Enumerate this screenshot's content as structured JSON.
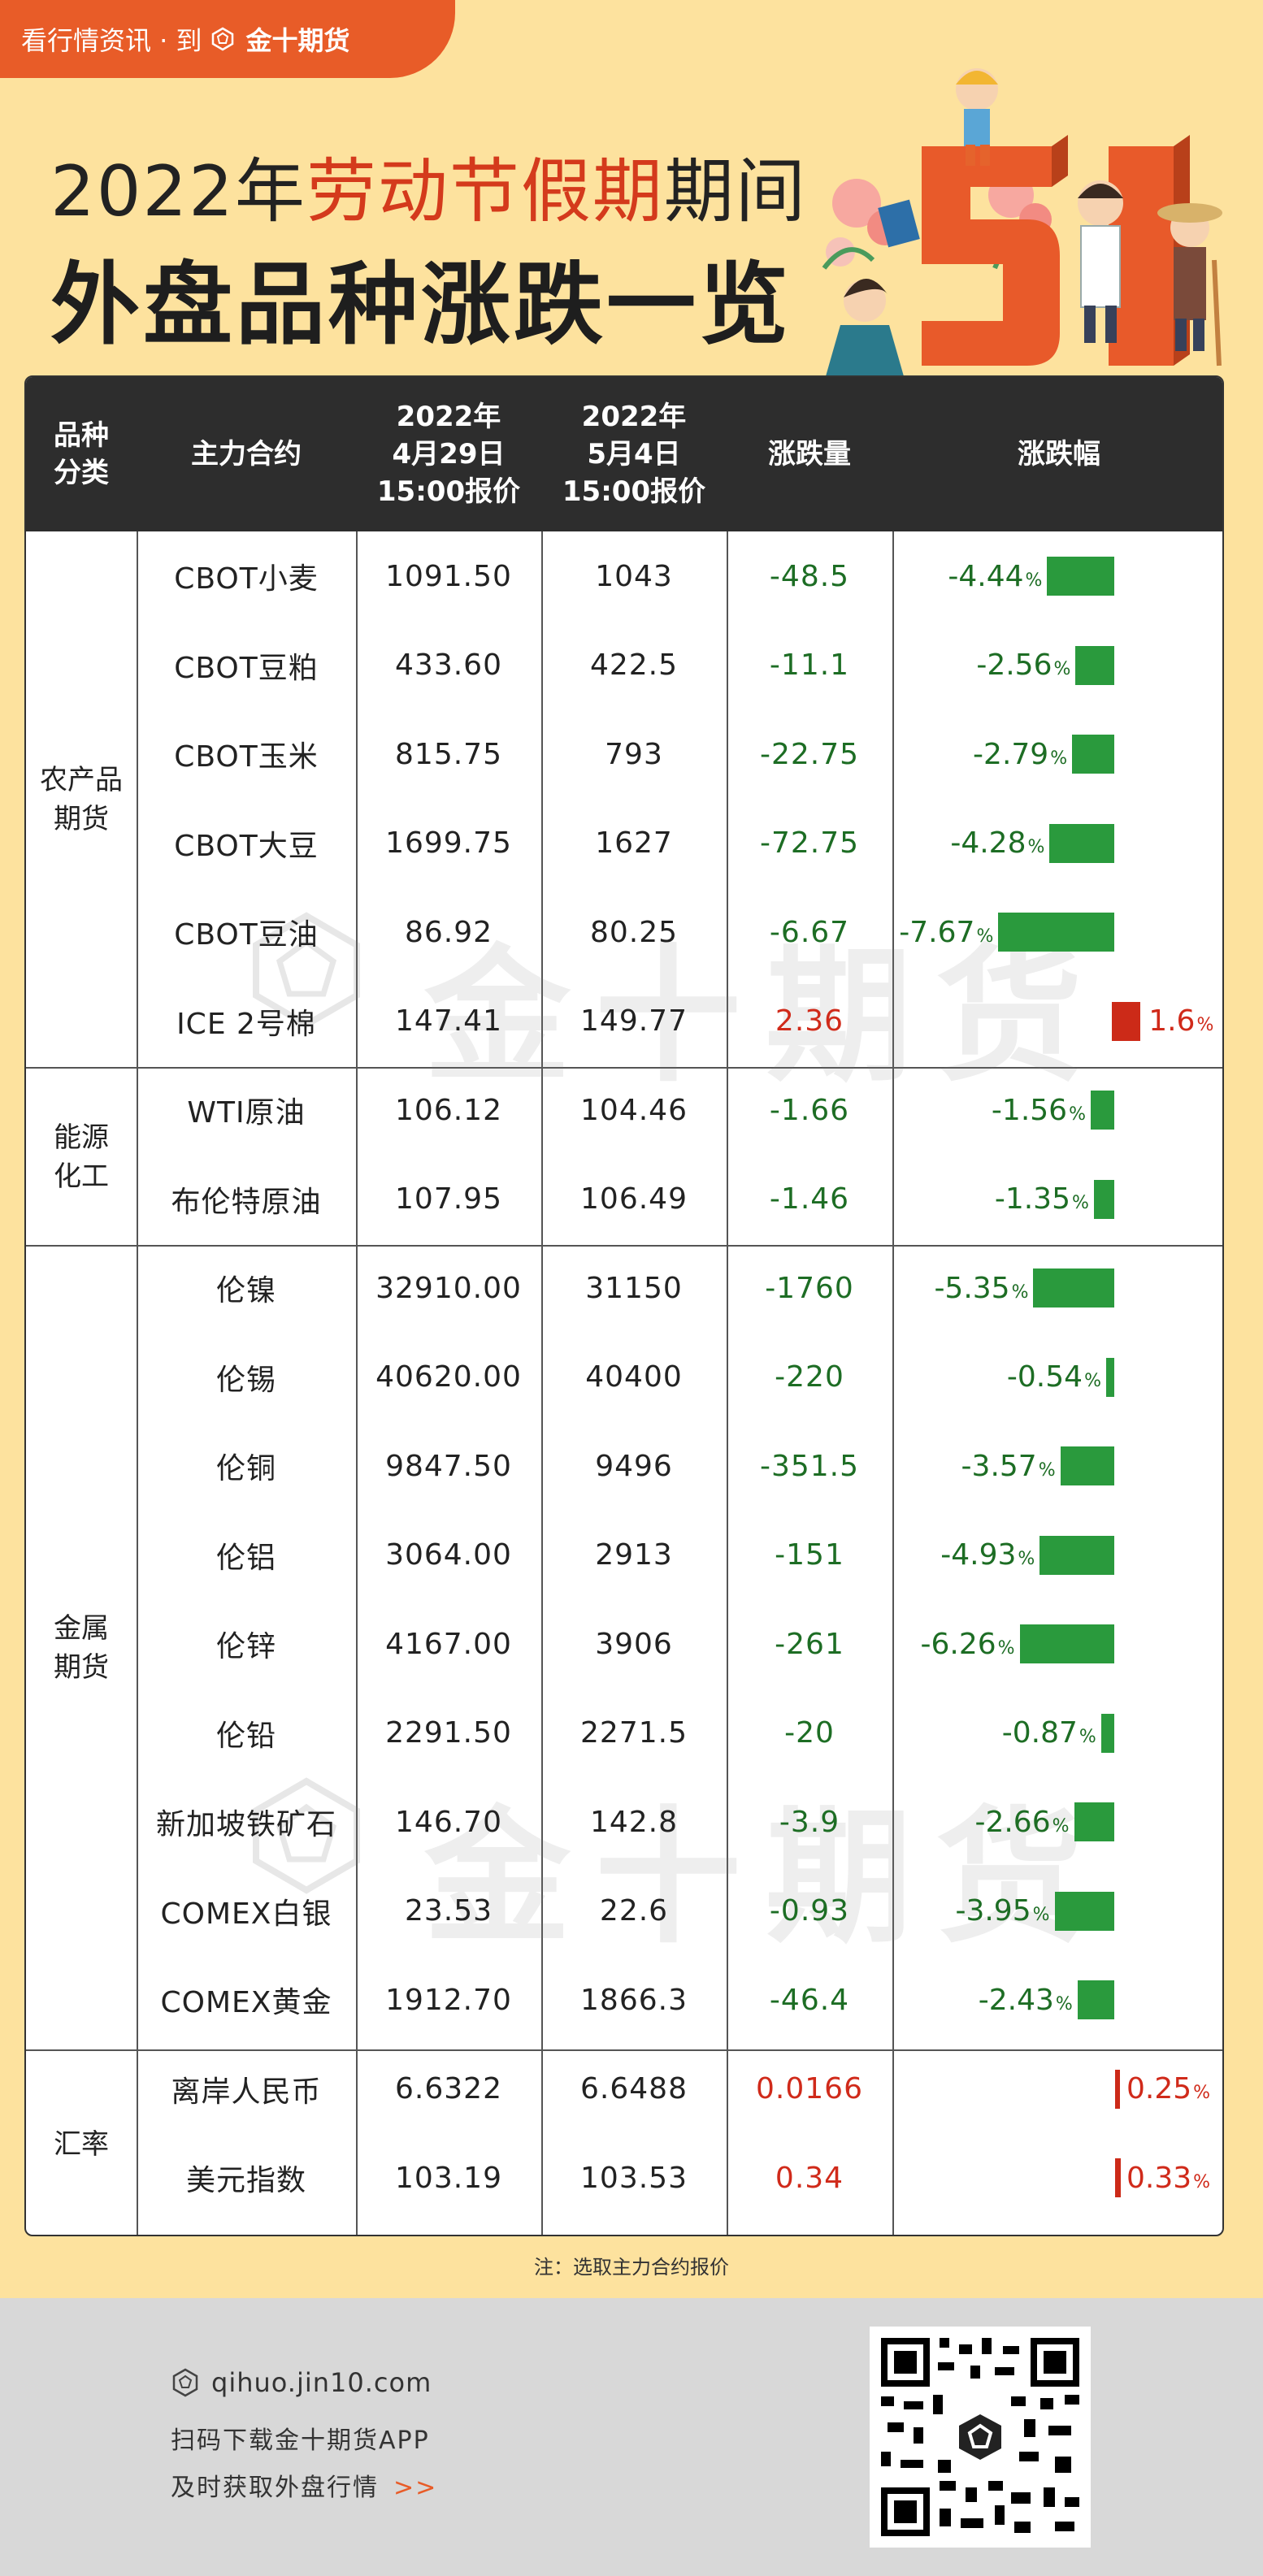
{
  "header": {
    "bar_text": "看行情资讯 · 到",
    "brand": "金十期货",
    "title_prefix": "2022年",
    "title_highlight": "劳动节假期",
    "title_suffix": "期间",
    "subtitle": "外盘品种涨跌一览"
  },
  "table": {
    "columns": [
      "品种\n分类",
      "主力合约",
      "2022年\n4月29日\n15:00报价",
      "2022年\n5月4日\n15:00报价",
      "涨跌量",
      "涨跌幅"
    ],
    "categories": [
      {
        "name": "农产品\n期货"
      },
      {
        "name": "能源\n化工"
      },
      {
        "name": "金属\n期货"
      },
      {
        "name": "汇率"
      }
    ],
    "rows": [
      {
        "contract": "CBOT小麦",
        "p1": "1091.50",
        "p2": "1043",
        "chg": "-48.5",
        "pct": "-4.44",
        "pct_value": -4.44
      },
      {
        "contract": "CBOT豆粕",
        "p1": "433.60",
        "p2": "422.5",
        "chg": "-11.1",
        "pct": "-2.56",
        "pct_value": -2.56
      },
      {
        "contract": "CBOT玉米",
        "p1": "815.75",
        "p2": "793",
        "chg": "-22.75",
        "pct": "-2.79",
        "pct_value": -2.79
      },
      {
        "contract": "CBOT大豆",
        "p1": "1699.75",
        "p2": "1627",
        "chg": "-72.75",
        "pct": "-4.28",
        "pct_value": -4.28
      },
      {
        "contract": "CBOT豆油",
        "p1": "86.92",
        "p2": "80.25",
        "chg": "-6.67",
        "pct": "-7.67",
        "pct_value": -7.67
      },
      {
        "contract": "ICE 2号棉",
        "p1": "147.41",
        "p2": "149.77",
        "chg": "2.36",
        "pct": "1.6",
        "pct_value": 1.6
      },
      {
        "contract": "WTI原油",
        "p1": "106.12",
        "p2": "104.46",
        "chg": "-1.66",
        "pct": "-1.56",
        "pct_value": -1.56
      },
      {
        "contract": "布伦特原油",
        "p1": "107.95",
        "p2": "106.49",
        "chg": "-1.46",
        "pct": "-1.35",
        "pct_value": -1.35
      },
      {
        "contract": "伦镍",
        "p1": "32910.00",
        "p2": "31150",
        "chg": "-1760",
        "pct": "-5.35",
        "pct_value": -5.35
      },
      {
        "contract": "伦锡",
        "p1": "40620.00",
        "p2": "40400",
        "chg": "-220",
        "pct": "-0.54",
        "pct_value": -0.54
      },
      {
        "contract": "伦铜",
        "p1": "9847.50",
        "p2": "9496",
        "chg": "-351.5",
        "pct": "-3.57",
        "pct_value": -3.57
      },
      {
        "contract": "伦铝",
        "p1": "3064.00",
        "p2": "2913",
        "chg": "-151",
        "pct": "-4.93",
        "pct_value": -4.93
      },
      {
        "contract": "伦锌",
        "p1": "4167.00",
        "p2": "3906",
        "chg": "-261",
        "pct": "-6.26",
        "pct_value": -6.26
      },
      {
        "contract": "伦铅",
        "p1": "2291.50",
        "p2": "2271.5",
        "chg": "-20",
        "pct": "-0.87",
        "pct_value": -0.87
      },
      {
        "contract": "新加坡铁矿石",
        "p1": "146.70",
        "p2": "142.8",
        "chg": "-3.9",
        "pct": "-2.66",
        "pct_value": -2.66
      },
      {
        "contract": "COMEX白银",
        "p1": "23.53",
        "p2": "22.6",
        "chg": "-0.93",
        "pct": "-3.95",
        "pct_value": -3.95
      },
      {
        "contract": "COMEX黄金",
        "p1": "1912.70",
        "p2": "1866.3",
        "chg": "-46.4",
        "pct": "-2.43",
        "pct_value": -2.43
      },
      {
        "contract": "离岸人民币",
        "p1": "6.6322",
        "p2": "6.6488",
        "chg": "0.0166",
        "pct": "0.25",
        "pct_value": 0.25
      },
      {
        "contract": "美元指数",
        "p1": "103.19",
        "p2": "103.53",
        "chg": "0.34",
        "pct": "0.33",
        "pct_value": 0.33
      }
    ],
    "pct_unit": "%",
    "watermark": "金十期货"
  },
  "colors": {
    "background": "#fde29e",
    "accent": "#e85c28",
    "header_bg": "#2d2d2d",
    "negative": "#2a9a3d",
    "positive": "#cc2a18"
  },
  "note": "注：选取主力合约报价",
  "footer": {
    "site": "qihuo.jin10.com",
    "line2": "扫码下载金十期货APP",
    "line3": "及时获取外盘行情",
    "arrows": ">>"
  }
}
